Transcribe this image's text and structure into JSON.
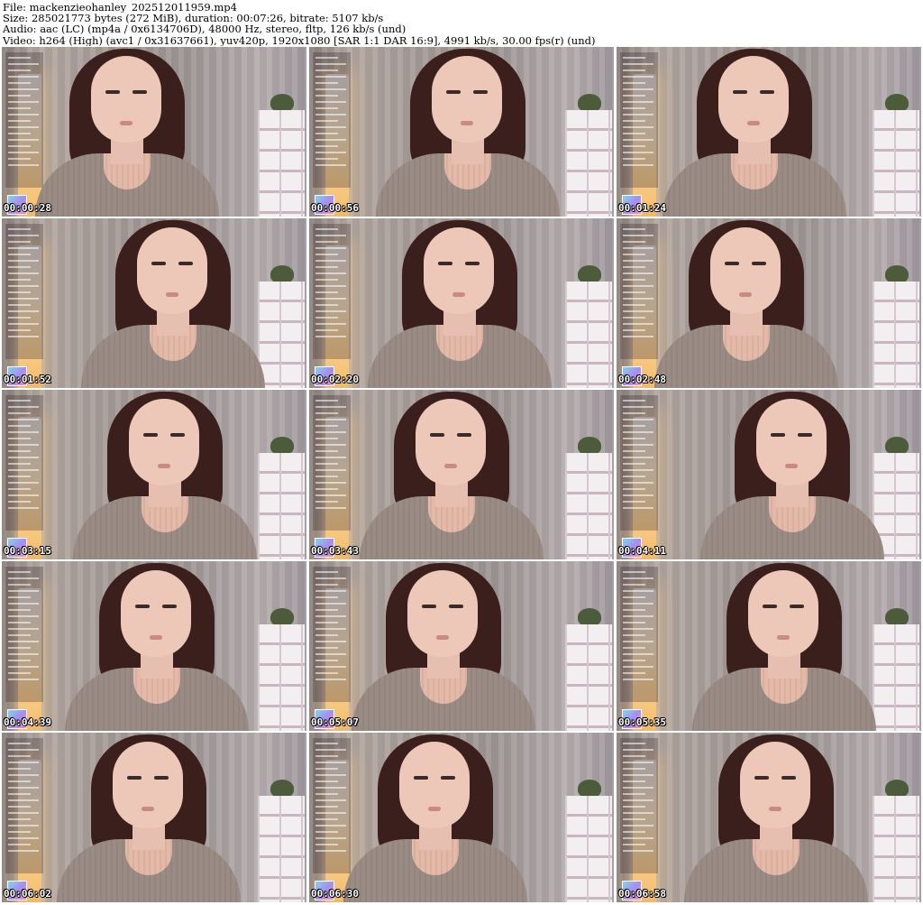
{
  "header": {
    "file": "File: mackenzieohanley_202512011959.mp4",
    "size": "Size: 285021773 bytes (272 MiB), duration: 00:07:26, bitrate: 5107 kb/s",
    "audio": "Audio: aac (LC) (mp4a / 0x6134706D), 48000 Hz, stereo, fltp, 126 kb/s (und)",
    "video": "Video: h264 (High) (avc1 / 0x31637661), yuv420p, 1920x1080 [SAR 1:1 DAR 16:9], 4991 kb/s, 30.00 fps(r) (und)"
  },
  "thumbnails": [
    {
      "timestamp": "00:00:28"
    },
    {
      "timestamp": "00:00:56"
    },
    {
      "timestamp": "00:01:24"
    },
    {
      "timestamp": "00:01:52"
    },
    {
      "timestamp": "00:02:20"
    },
    {
      "timestamp": "00:02:48"
    },
    {
      "timestamp": "00:03:15"
    },
    {
      "timestamp": "00:03:43"
    },
    {
      "timestamp": "00:04:11"
    },
    {
      "timestamp": "00:04:39"
    },
    {
      "timestamp": "00:05:07"
    },
    {
      "timestamp": "00:05:35"
    },
    {
      "timestamp": "00:06:02"
    },
    {
      "timestamp": "00:06:30"
    },
    {
      "timestamp": "00:06:58"
    }
  ]
}
